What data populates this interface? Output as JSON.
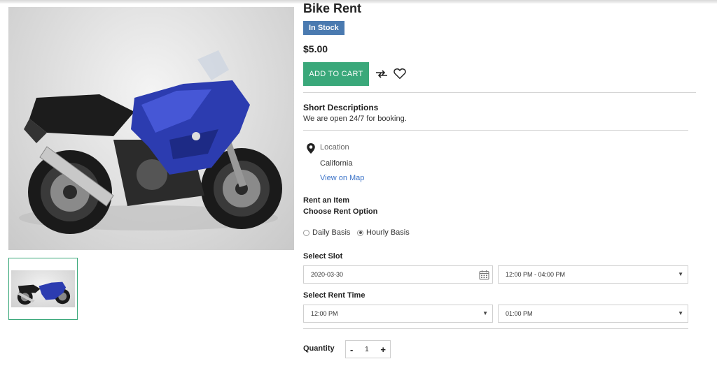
{
  "product": {
    "title": "Bike Rent",
    "stock_badge": "In Stock",
    "price": "$5.00",
    "add_to_cart_label": "ADD TO CART"
  },
  "short_description": {
    "heading": "Short Descriptions",
    "text": "We are open 24/7 for booking."
  },
  "location": {
    "label": "Location",
    "value": "California",
    "map_link": "View on Map"
  },
  "rent": {
    "heading": "Rent an Item",
    "option_heading": "Choose Rent Option",
    "options": [
      {
        "label": "Daily Basis",
        "checked": false
      },
      {
        "label": "Hourly Basis",
        "checked": true
      }
    ]
  },
  "slot": {
    "heading": "Select Slot",
    "date": "2020-03-30",
    "time_range": "12:00 PM - 04:00 PM"
  },
  "rent_time": {
    "heading": "Select Rent Time",
    "start": "12:00 PM",
    "end": "01:00 PM"
  },
  "quantity": {
    "label": "Quantity",
    "minus": "-",
    "value": "1",
    "plus": "+"
  },
  "colors": {
    "accent_green": "#3aa87a",
    "badge_blue": "#4a7ab0",
    "link_blue": "#3a72c8"
  },
  "icons": [
    "compare-icon",
    "heart-icon",
    "map-pin-icon",
    "calendar-icon",
    "chevron-down-icon"
  ]
}
